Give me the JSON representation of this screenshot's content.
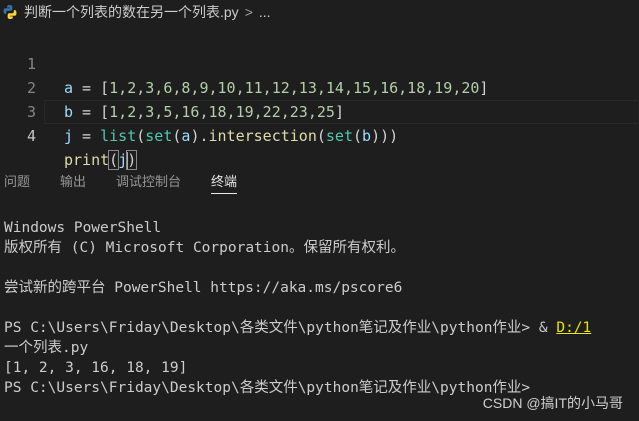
{
  "breadcrumb": {
    "file": "判断一个列表的数在另一个列表.py",
    "separator": ">",
    "more": "..."
  },
  "colors": {
    "background": "#1e1e1e",
    "python_icon_blue": "#3572a5",
    "python_icon_yellow": "#ffd43b",
    "link_yellow": "#e5e510"
  },
  "editor": {
    "lines": [
      {
        "number": "1",
        "var": "a",
        "op": " = ",
        "open": "[",
        "nums": "1,2,3,6,8,9,10,11,12,13,14,15,16,18,19,20",
        "close": "]"
      },
      {
        "number": "2",
        "var": "b",
        "op": " = ",
        "open": "[",
        "nums": "1,2,3,5,16,18,19,22,23,25",
        "close": "]"
      },
      {
        "number": "3",
        "var": "j",
        "op": " = ",
        "list": "list",
        "p1": "(",
        "set1": "set",
        "p2": "(",
        "a": "a",
        "p3": ").",
        "method": "intersection",
        "p4": "(",
        "set2": "set",
        "p5": "(",
        "b": "b",
        "p6": ")))"
      },
      {
        "number": "4",
        "fn": "print",
        "open": "(",
        "arg": "j",
        "close": ")"
      }
    ]
  },
  "panel": {
    "tabs": [
      "问题",
      "输出",
      "调试控制台",
      "终端"
    ],
    "active_tab": "终端"
  },
  "terminal": {
    "lines": [
      "Windows PowerShell",
      "版权所有 (C) Microsoft Corporation。保留所有权利。",
      "",
      "尝试新的跨平台 PowerShell https://aka.ms/pscore6",
      "",
      "PS C:\\Users\\Friday\\Desktop\\各类文件\\python笔记及作业\\python作业> & ",
      "一个列表.py",
      "[1, 2, 3, 16, 18, 19]",
      "PS C:\\Users\\Friday\\Desktop\\各类文件\\python笔记及作业\\python作业> "
    ],
    "command_link": "D:/1"
  },
  "watermark": "CSDN @搞IT的小马哥"
}
